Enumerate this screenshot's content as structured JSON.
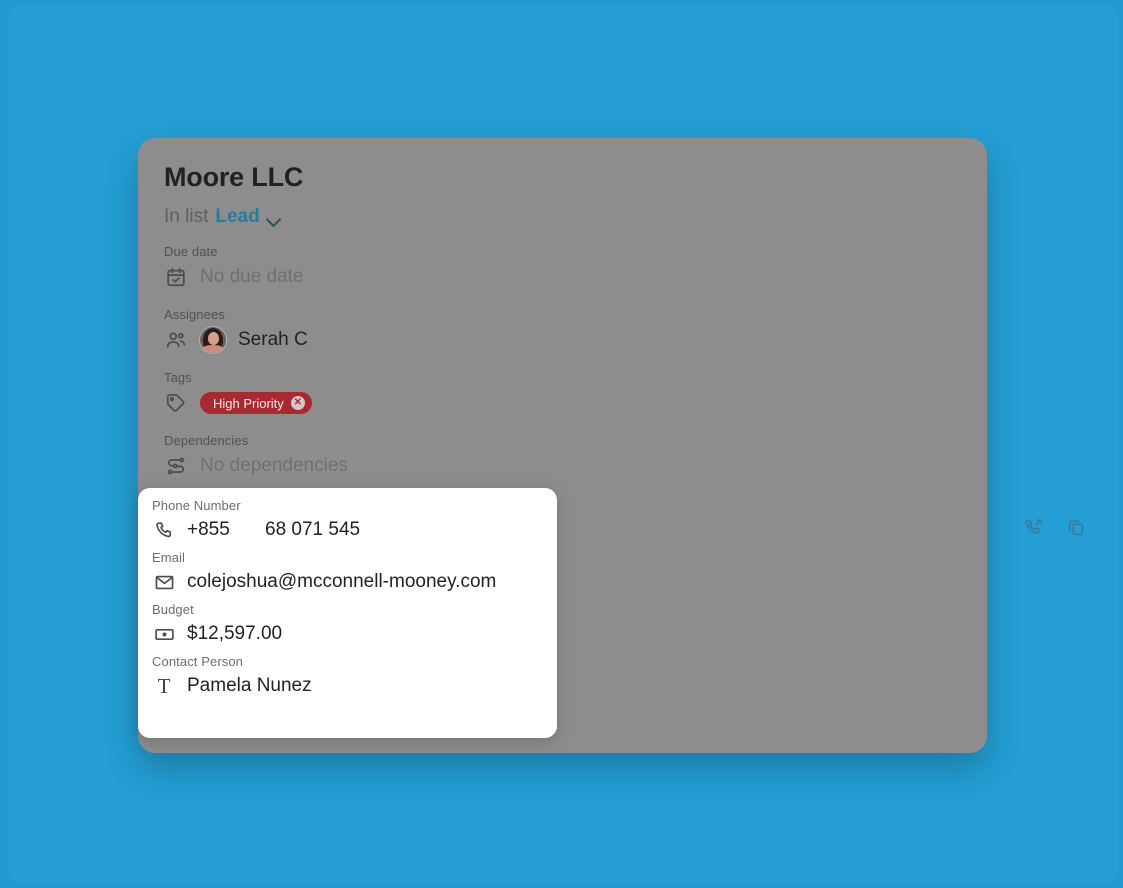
{
  "theme": {
    "page_background": "#2099d1",
    "card_overlay": "#8d8d8d",
    "accent_blue": "#2a7a9b",
    "action_icon_blue": "#3a7a9e",
    "tag_red": "#a82a30",
    "popover_background": "#ffffff"
  },
  "card": {
    "title": "Moore LLC",
    "in_list_prefix": "In list",
    "in_list_value": "Lead",
    "list_dropdown_icon": "chevron-down-icon",
    "fields": [
      {
        "label": "Due date",
        "icon": "calendar-check-icon",
        "value": "No due date",
        "muted": true
      },
      {
        "label": "Assignees",
        "icon": "people-icon",
        "value": "Serah C",
        "muted": false
      },
      {
        "label": "Tags",
        "icon": "tag-icon",
        "value": "High Priority",
        "remove_label": "✕"
      },
      {
        "label": "Dependencies",
        "icon": "dependencies-icon",
        "value": "No dependencies",
        "muted": true
      }
    ]
  },
  "row_actions": [
    {
      "icon": "call-outgoing-icon",
      "name": "call-button"
    },
    {
      "icon": "copy-icon",
      "name": "copy-button"
    }
  ],
  "popover": {
    "fields": [
      {
        "label": "Phone Number",
        "icon": "phone-icon",
        "country_code": "+855",
        "number": "68 071 545"
      },
      {
        "label": "Email",
        "icon": "envelope-icon",
        "value": "colejoshua@mcconnell-mooney.com"
      },
      {
        "label": "Budget",
        "icon": "banknote-icon",
        "value": "$12,597.00"
      },
      {
        "label": "Contact Person",
        "icon": "text-field-icon",
        "value": "Pamela Nunez"
      }
    ]
  }
}
